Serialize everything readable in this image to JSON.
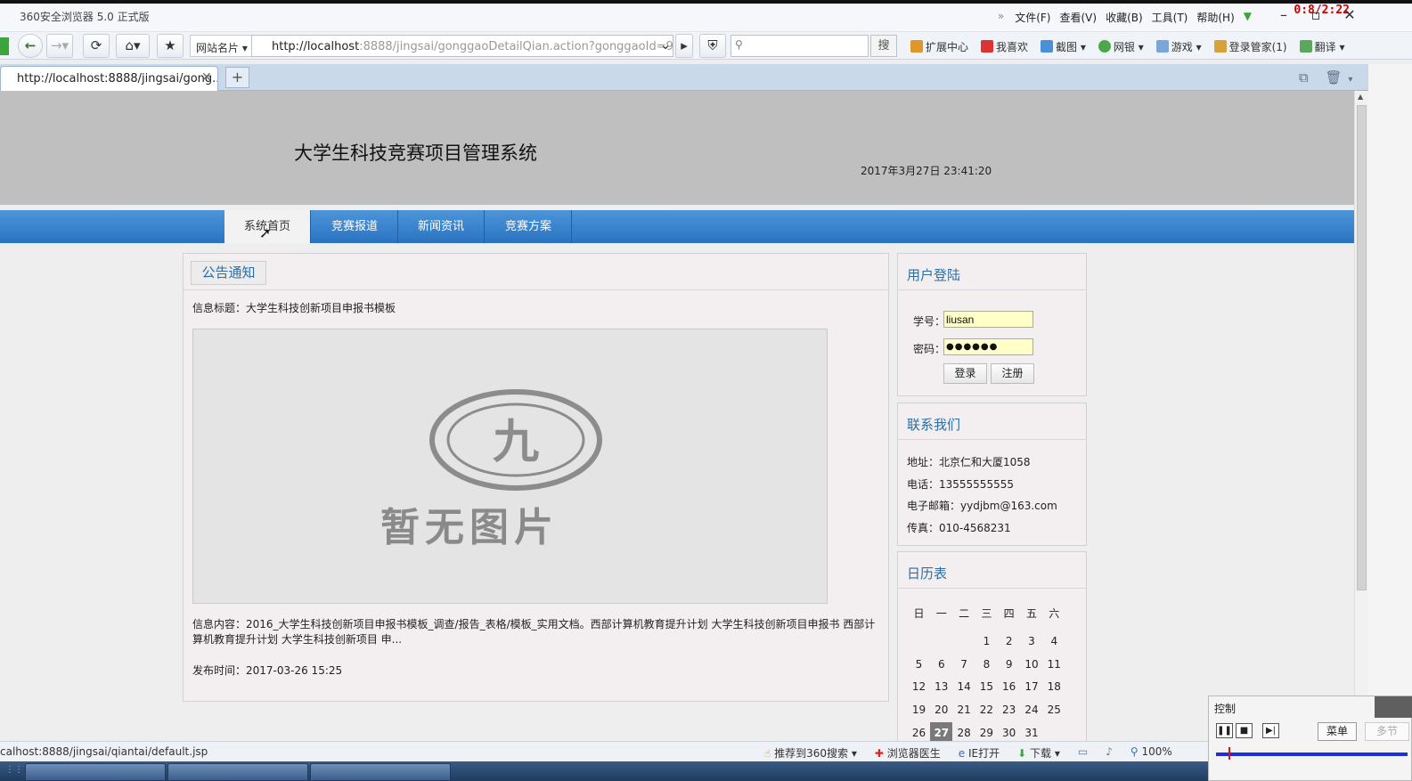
{
  "browser": {
    "app_title": "360安全浏览器 5.0 正式版",
    "menus": [
      "文件(F)",
      "查看(V)",
      "收藏(B)",
      "工具(T)",
      "帮助(H)"
    ],
    "timer": "0:8/2:22",
    "site_names_label": "网站名片",
    "url_host": "http://localhost",
    "url_rest": ":8888/jingsai/gonggaoDetailQian.action?gonggaoId=9",
    "search_button": "搜",
    "extensions": [
      "扩展中心",
      "我喜欢",
      "截图",
      "网银",
      "游戏",
      "登录管家(1)",
      "翻译"
    ],
    "tab_title": "http://localhost:8888/jingsai/gong...",
    "status_url": "calhost:8888/jingsai/qiantai/default.jsp",
    "status_items": [
      "推荐到360搜索",
      "浏览器医生",
      "IE打开",
      "下载",
      "100%"
    ],
    "colors": {
      "nav_blue": "#2a73c2",
      "title_blue": "#2c6ea5",
      "header_gray": "#bfbfbf"
    }
  },
  "site": {
    "title": "大学生科技竞赛项目管理系统",
    "datetime": "2017年3月27日 23:41:20",
    "nav": [
      "系统首页",
      "竞赛报道",
      "新闻资讯",
      "竞赛方案"
    ]
  },
  "notice": {
    "heading": "公告通知",
    "title_line": "信息标题：大学生科技创新项目申报书模板",
    "no_image_text": "暂无图片",
    "content": "信息内容：2016_大学生科技创新项目申报书模板_调查/报告_表格/模板_实用文档。西部计算机教育提升计划 大学生科技创新项目申报书 西部计算机教育提升计划 大学生科技创新项目 申...",
    "publish_time": "发布时间：2017-03-26 15:25"
  },
  "login": {
    "heading": "用户登陆",
    "id_label": "学号：",
    "id_value": "liusan",
    "pwd_label": "密码：",
    "pwd_value": "●●●●●●",
    "login_button": "登录",
    "register_button": "注册"
  },
  "contact": {
    "heading": "联系我们",
    "address": "地址：北京仁和大厦1058",
    "phone": "电话：13555555555",
    "email": "电子邮箱：yydjbm@163.com",
    "fax": "传真：010-4568231"
  },
  "calendar": {
    "heading": "日历表",
    "weekdays": [
      "日",
      "一",
      "二",
      "三",
      "四",
      "五",
      "六"
    ],
    "weeks": [
      [
        "",
        "",
        "",
        "1",
        "2",
        "3",
        "4"
      ],
      [
        "5",
        "6",
        "7",
        "8",
        "9",
        "10",
        "11"
      ],
      [
        "12",
        "13",
        "14",
        "15",
        "16",
        "17",
        "18"
      ],
      [
        "19",
        "20",
        "21",
        "22",
        "23",
        "24",
        "25"
      ],
      [
        "26",
        "27",
        "28",
        "29",
        "30",
        "31",
        ""
      ]
    ],
    "today": "27"
  },
  "control_panel": {
    "title": "控制",
    "menu_button": "菜单",
    "more_button": "多节"
  }
}
